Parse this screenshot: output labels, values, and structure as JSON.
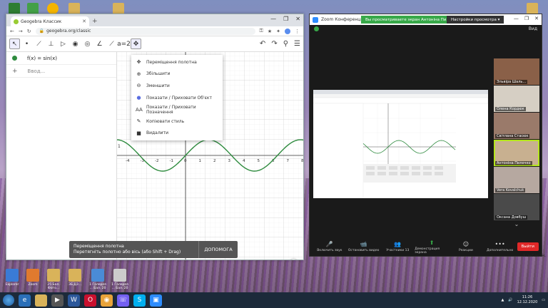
{
  "browser": {
    "tab_title": "Geogebra Классик",
    "address": "geogebra.org/classic",
    "new_tab": "+",
    "window_buttons": [
      "—",
      "❐",
      "✕"
    ]
  },
  "geogebra": {
    "algebra_entry": "f(x)  =  sin(x)",
    "algebra_input": "Ввод...",
    "menu_items": [
      {
        "icon": "move-icon",
        "glyph": "✥",
        "label": "Переміщення полотна"
      },
      {
        "icon": "zoom-in-icon",
        "glyph": "⊕",
        "label": "Збільшити"
      },
      {
        "icon": "zoom-out-icon",
        "glyph": "⊖",
        "label": "Зменшити"
      },
      {
        "icon": "show-hide-object-icon",
        "glyph": "●",
        "label": "Показати / Приховати Об'єкт"
      },
      {
        "icon": "show-hide-label-icon",
        "glyph": "AA",
        "label": "Показати / Приховати Позначення"
      },
      {
        "icon": "copy-style-icon",
        "glyph": "✎",
        "label": "Копіювати стиль"
      },
      {
        "icon": "delete-icon",
        "glyph": "■",
        "label": "Видалити"
      }
    ],
    "toast_line1": "Переміщення полотна",
    "toast_line2": "Перетягніть полотно або вісь (або Shift + Drag)",
    "toast_help": "ДОПОМОГА",
    "x_ticks": [
      "-4",
      "-3",
      "-2",
      "-1",
      "0",
      "1",
      "2",
      "3",
      "4",
      "5",
      "6",
      "7",
      "8"
    ],
    "axis_one_label": "1",
    "curve_color": "#2e8b3e"
  },
  "zoom": {
    "title": "Zoom Конференция 20 к...",
    "share_banner": "Вы просматриваете экран Антоніна Пилечко",
    "settings_banner": "Настройки просмотра ▾",
    "view_label": "Вид",
    "participants": [
      {
        "name": "Эльвіра Шаль..."
      },
      {
        "name": "Олена Кордюк"
      },
      {
        "name": "Світлана Стасюк"
      },
      {
        "name": "Антоніна Пилечко"
      },
      {
        "name": "Vera Kovalchuk"
      },
      {
        "name": "Оксана Довбуш"
      }
    ],
    "chevron": "⌄",
    "footer": [
      {
        "icon": "mic-off-icon",
        "glyph": "🎤",
        "label": "Включить звук"
      },
      {
        "icon": "video-off-icon",
        "glyph": "📹",
        "label": "Остановить видео"
      },
      {
        "icon": "participants-icon",
        "glyph": "👥",
        "label": "Участники  13"
      },
      {
        "icon": "share-screen-icon",
        "glyph": "⬆",
        "label": "Демонстрация экрана"
      },
      {
        "icon": "reactions-icon",
        "glyph": "☺",
        "label": "Реакции"
      },
      {
        "icon": "more-icon",
        "glyph": "•••",
        "label": "Дополнительно"
      }
    ],
    "end_label": "Выйти",
    "status": "Контактн."
  },
  "desktop": {
    "icons": [
      {
        "label": "Explorer",
        "color": "#3a7bd5"
      },
      {
        "label": "Zoom",
        "color": "#e07a2e"
      },
      {
        "label": "25 Бал. Фото...",
        "color": "#d9b35a"
      },
      {
        "label": "ЗБ.ДЗ...",
        "color": "#d9b35a"
      },
      {
        "label": "1 Галерея ... Бал. 20",
        "color": "#4a8bd6"
      },
      {
        "label": "1 Галерея ... Бал. 20",
        "color": "#cccccc"
      }
    ]
  },
  "taskbar": {
    "clock_time": "11:26",
    "clock_date": "12.12.2020"
  }
}
